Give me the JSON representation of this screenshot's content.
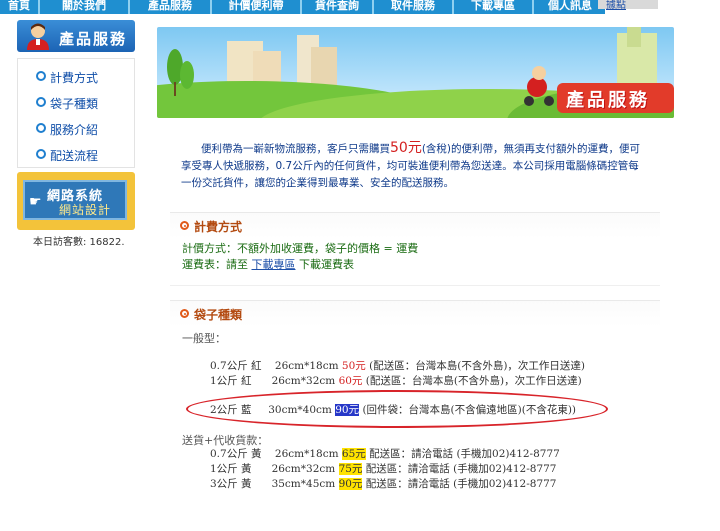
{
  "nav": {
    "tabs": [
      "首頁",
      "關於我們",
      "產品服務",
      "計價便利帶",
      "貨件查詢",
      "取件服務",
      "下載專區",
      "個人訊息"
    ],
    "login": "據點"
  },
  "sidebar": {
    "header": "產品服務",
    "items": [
      "計費方式",
      "袋子種類",
      "服務介紹",
      "配送流程"
    ],
    "ad_line1": "網路系統",
    "ad_line2": "網站設計",
    "visitors": "本日訪客數: 16822."
  },
  "hero": {
    "title": "產品服務"
  },
  "intro": {
    "p1": "便利帶為一嶄新物流服務，客戶只需購買",
    "price": "50元",
    "p2": "(含稅)的便利帶，無須再支付額外的運費，便可",
    "line2": "享受專人快遞服務，0.7公斤內的任何貨件，均可裝進便利帶為您送達。本公司採用電腦條碼控管每",
    "line3": "一份交託貨件，讓您的企業得到最專業、安全的配送服務。"
  },
  "billing": {
    "header": "計費方式",
    "line1": "計價方式：不額外加收運費，袋子的價格 = 運費",
    "line2_prefix": "運費表：請至 ",
    "line2_link": "下載專區",
    "line2_suffix": " 下載運費表"
  },
  "bags": {
    "header": "袋子種類",
    "general_label": "一般型：",
    "general": [
      {
        "w": "0.7公斤 紅",
        "size": "26cm*18cm",
        "price": "50元",
        "note": "(配送區：台灣本島(不含外島)，次工作日送達)"
      },
      {
        "w": "1公斤 紅",
        "size": "26cm*32cm",
        "price": "60元",
        "note": "(配送區：台灣本島(不含外島)，次工作日送達)"
      }
    ],
    "return": {
      "w": "2公斤 藍",
      "size": "30cm*40cm",
      "price": "90元",
      "note": "(回件袋：台灣本島(不含偏遠地區)(不含花東))"
    },
    "cod_label": "送貨+代收貨款：",
    "cod": [
      {
        "w": "0.7公斤 黃",
        "size": "26cm*18cm",
        "price": "65元",
        "note": "配送區：請洽電話 (手機加02)412-8777"
      },
      {
        "w": "1公斤 黃",
        "size": "26cm*32cm",
        "price": "75元",
        "note": "配送區：請洽電話 (手機加02)412-8777"
      },
      {
        "w": "3公斤 黃",
        "size": "35cm*45cm",
        "price": "90元",
        "note": "配送區：請洽電話 (手機加02)412-8777"
      }
    ]
  },
  "colors": {
    "nav": "#1f8fd0",
    "accent": "#e05a1a",
    "link": "#1d4fa8",
    "highlight_blue": "#2637c8",
    "highlight_yellow": "#ffe300",
    "annotation": "#d8242a"
  }
}
